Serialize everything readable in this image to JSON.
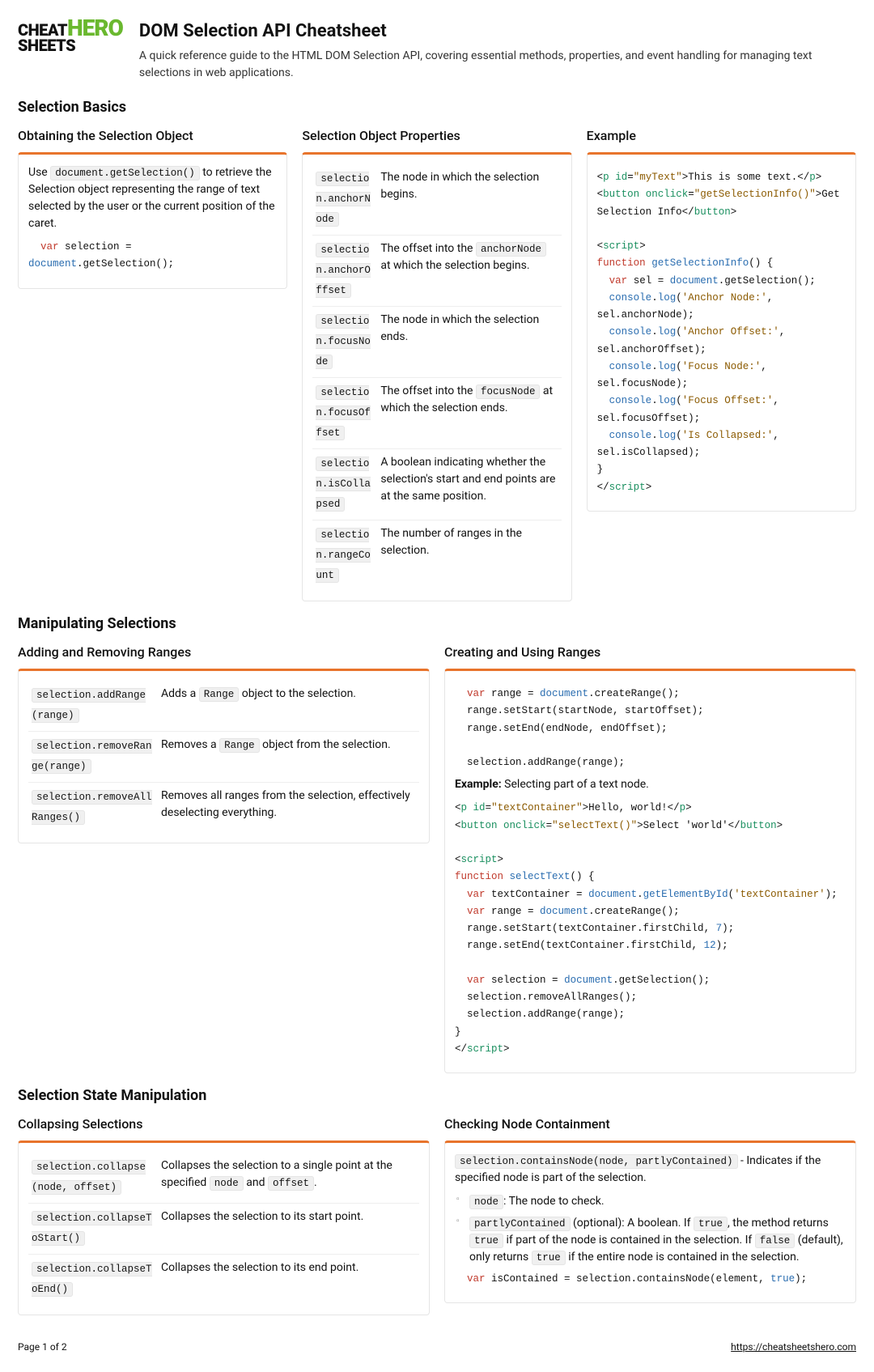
{
  "logo": {
    "l1a": "CHEAT",
    "l1b": "HERO",
    "l2": "SHEETS"
  },
  "header": {
    "title": "DOM Selection API Cheatsheet",
    "subtitle": "A quick reference guide to the HTML DOM Selection API, covering essential methods, properties, and event handling for managing text selections in web applications."
  },
  "s1": {
    "heading": "Selection Basics",
    "c1": {
      "title": "Obtaining the Selection Object",
      "desc_pre": "Use ",
      "desc_code": "document.getSelection()",
      "desc_post": " to retrieve the Selection object representing the range of text selected by the user or the current position of the caret."
    },
    "c2": {
      "title": "Selection Object Properties",
      "rows": [
        {
          "k": "selection.anchorNode",
          "v": "The node in which the selection begins."
        },
        {
          "k": "selection.anchorOffset",
          "v_pre": "The offset into the ",
          "v_code": "anchorNode",
          "v_post": " at which the selection begins."
        },
        {
          "k": "selection.focusNode",
          "v": "The node in which the selection ends."
        },
        {
          "k": "selection.focusOffset",
          "v_pre": "The offset into the ",
          "v_code": "focusNode",
          "v_post": " at which the selection ends."
        },
        {
          "k": "selection.isCollapsed",
          "v": "A boolean indicating whether the selection's start and end points are at the same position."
        },
        {
          "k": "selection.rangeCount",
          "v": "The number of ranges in the selection."
        }
      ]
    },
    "c3": {
      "title": "Example"
    }
  },
  "s2": {
    "heading": "Manipulating Selections",
    "c1": {
      "title": "Adding and Removing Ranges",
      "rows": [
        {
          "k": "selection.addRange(range)",
          "v_pre": "Adds a ",
          "v_code": "Range",
          "v_post": " object to the selection."
        },
        {
          "k": "selection.removeRange(range)",
          "v_pre": "Removes a ",
          "v_code": "Range",
          "v_post": " object from the selection."
        },
        {
          "k": "selection.removeAllRanges()",
          "v": "Removes all ranges from the selection, effectively deselecting everything."
        }
      ]
    },
    "c2": {
      "title": "Creating and Using Ranges",
      "example_label": "Example:",
      "example_text": " Selecting part of a text node."
    }
  },
  "s3": {
    "heading": "Selection State Manipulation",
    "c1": {
      "title": "Collapsing Selections",
      "rows": [
        {
          "k": "selection.collapse(node, offset)",
          "v_pre": "Collapses the selection to a single point at the specified ",
          "v_code1": "node",
          "v_mid": " and ",
          "v_code2": "offset",
          "v_post": "."
        },
        {
          "k": "selection.collapseToStart()",
          "v": "Collapses the selection to its start point."
        },
        {
          "k": "selection.collapseToEnd()",
          "v": "Collapses the selection to its end point."
        }
      ]
    },
    "c2": {
      "title": "Checking Node Containment",
      "intro_code": "selection.containsNode(node, partlyContained)",
      "intro_post": " - Indicates if the specified node is part of the selection.",
      "li1_code": "node",
      "li1_post": ": The node to check.",
      "li2_c1": "partlyContained",
      "li2_t1": " (optional): A boolean. If ",
      "li2_c2": "true",
      "li2_t2": ", the method returns ",
      "li2_c3": "true",
      "li2_t3": " if part of the node is contained in the selection. If ",
      "li2_c4": "false",
      "li2_t4": " (default), only returns ",
      "li2_c5": "true",
      "li2_t5": " if the entire node is contained in the selection."
    }
  },
  "footer": {
    "page": "Page 1 of 2",
    "url": "https://cheatsheetshero.com"
  }
}
